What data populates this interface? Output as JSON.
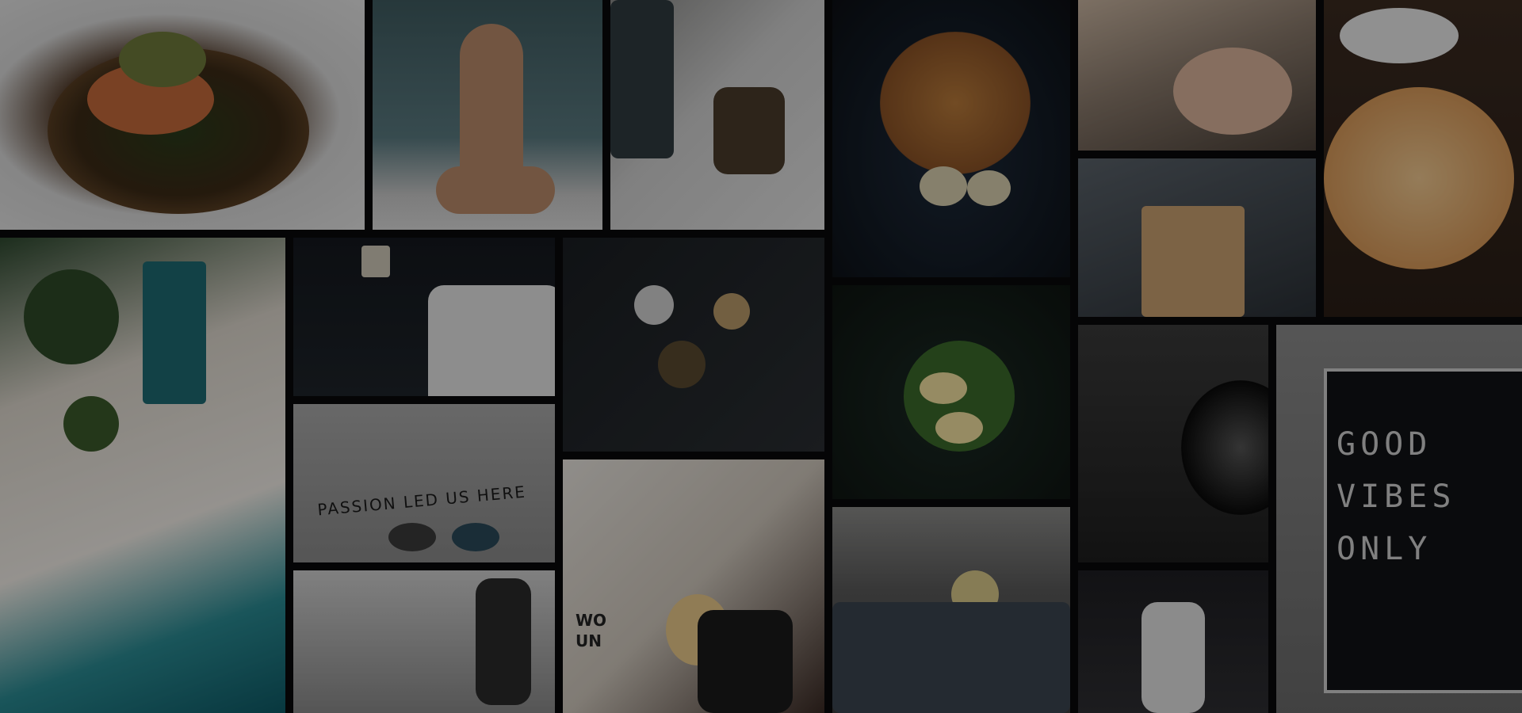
{
  "collage": {
    "style": "darkened photo mosaic background",
    "overlay_color": "#000000",
    "tiles": [
      {
        "id": "salmon-dish",
        "subject": "plated salmon with vegetables"
      },
      {
        "id": "woman-sea",
        "subject": "woman in bikini sitting by the sea"
      },
      {
        "id": "boat-bag",
        "subject": "bag on a boat deck"
      },
      {
        "id": "pancakes",
        "subject": "pancakes with blueberries and banana"
      },
      {
        "id": "spa-massage",
        "subject": "facial massage at spa"
      },
      {
        "id": "pizza",
        "subject": "pizza on a table"
      },
      {
        "id": "shopping-bag",
        "subject": "hands holding a paper shopping bag"
      },
      {
        "id": "aerial-beach",
        "subject": "aerial view of tropical beach and pool"
      },
      {
        "id": "hotel-bed",
        "subject": "hotel bed with lamp"
      },
      {
        "id": "coffee-table",
        "subject": "top view of coffee shop table"
      },
      {
        "id": "avocado-eggs",
        "subject": "avocado and egg plate"
      },
      {
        "id": "barbell-floor",
        "subject": "barbell on gym floor"
      },
      {
        "id": "letterboard",
        "subject": "letter board sign"
      },
      {
        "id": "passion-wall",
        "subject": "wall with lettering and sneakers"
      },
      {
        "id": "clothes-rack",
        "subject": "clothes rack shopping"
      },
      {
        "id": "breakfast-bed",
        "subject": "woman with breakfast in bed"
      },
      {
        "id": "barista",
        "subject": "barista working in cafe"
      },
      {
        "id": "gym-lift",
        "subject": "woman lifting barbell in gym"
      }
    ],
    "letterboard_text": "GOOD\nVIBES\nONLY",
    "wall_text": "PASSION LED US HERE",
    "tshirt_text": "WO\nUN"
  }
}
